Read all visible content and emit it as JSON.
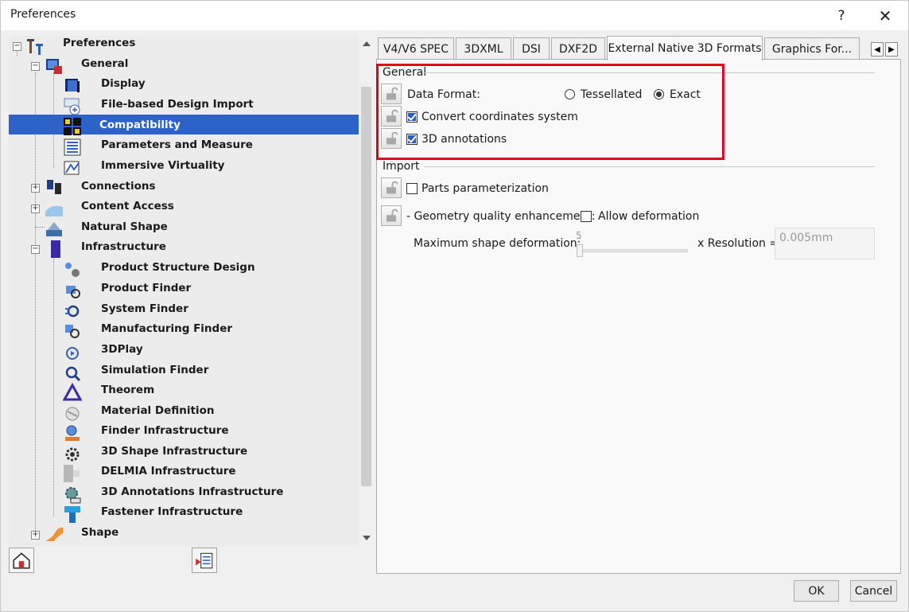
{
  "window": {
    "title": "Preferences",
    "help_glyph": "?",
    "close_glyph": "✕"
  },
  "tree": {
    "root": "Preferences",
    "general": "General",
    "items_general": [
      "Display",
      "File-based Design Import",
      "Compatibility",
      "Parameters and Measure",
      "Immersive Virtuality"
    ],
    "connections": "Connections",
    "content_access": "Content Access",
    "natural_shape": "Natural Shape",
    "infrastructure": "Infrastructure",
    "items_infrastructure": [
      "Product Structure Design",
      "Product Finder",
      "System Finder",
      "Manufacturing Finder",
      "3DPlay",
      "Simulation Finder",
      "Theorem",
      "Material Definition",
      "Finder Infrastructure",
      "3D Shape Infrastructure",
      "DELMIA Infrastructure",
      "3D Annotations Infrastructure",
      "Fastener Infrastructure"
    ],
    "shape": "Shape",
    "selected": "Compatibility"
  },
  "tabs": [
    "V4/V6 SPEC",
    "3DXML",
    "DSI",
    "DXF2D",
    "External Native 3D Formats",
    "Graphics For..."
  ],
  "active_tab": "External Native 3D Formats",
  "general_group": {
    "label": "General",
    "data_format_label": "Data Format:",
    "opt_tessellated": "Tessellated",
    "opt_exact": "Exact",
    "selected_format": "Exact",
    "convert_coords_label": "Convert coordinates system",
    "convert_coords_checked": true,
    "annotations_label": "3D annotations",
    "annotations_checked": true
  },
  "import_group": {
    "label": "Import",
    "parts_param_label": "Parts parameterization",
    "parts_param_checked": false,
    "geometry_label": "- Geometry quality enhancement:",
    "allow_deform_label": "Allow deformation",
    "allow_deform_checked": false,
    "max_shape_label": "Maximum shape deformation:",
    "slider_value": "5",
    "resolution_label": "x Resolution =",
    "resolution_value": "0.005mm"
  },
  "buttons": {
    "ok": "OK",
    "cancel": "Cancel"
  },
  "colors": {
    "selection": "#2d63c8",
    "highlight": "#e0001b",
    "checkbox": "#2b5ebf"
  }
}
